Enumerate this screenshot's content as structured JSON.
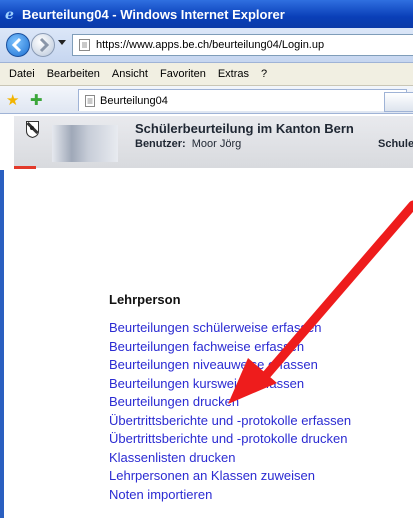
{
  "window": {
    "title": "Beurteilung04 - Windows Internet Explorer"
  },
  "address": {
    "url": "https://www.apps.be.ch/beurteilung04/Login.up"
  },
  "menu": [
    "Datei",
    "Bearbeiten",
    "Ansicht",
    "Favoriten",
    "Extras",
    "?"
  ],
  "tab": {
    "label": "Beurteilung04"
  },
  "header": {
    "title": "Schülerbeurteilung im Kanton Bern",
    "user_label": "Benutzer:",
    "user_name": "Moor Jörg",
    "right_label": "Schule"
  },
  "section": {
    "title": "Lehrperson"
  },
  "links": [
    "Beurteilungen schülerweise erfassen",
    "Beurteilungen fachweise erfassen",
    "Beurteilungen niveauweise erfassen",
    "Beurteilungen kursweise erfassen",
    "Beurteilungen drucken",
    "Übertrittsberichte und -protokolle erfassen",
    "Übertrittsberichte und -protokolle drucken",
    "Klassenlisten drucken",
    "Lehrpersonen an Klassen zuweisen",
    "Noten importieren"
  ],
  "selected_link": "Beurteilungen drucken",
  "colors": {
    "link": "#2b2bd2",
    "selection": "#d4d0c8",
    "arrow": "#ee1c1c",
    "titlebar": "#0a3fb8"
  },
  "icons": [
    "ie-logo-icon",
    "back-icon",
    "forward-icon",
    "favorites-star-icon",
    "add-favorite-icon",
    "page-icon",
    "bern-crest-icon"
  ]
}
